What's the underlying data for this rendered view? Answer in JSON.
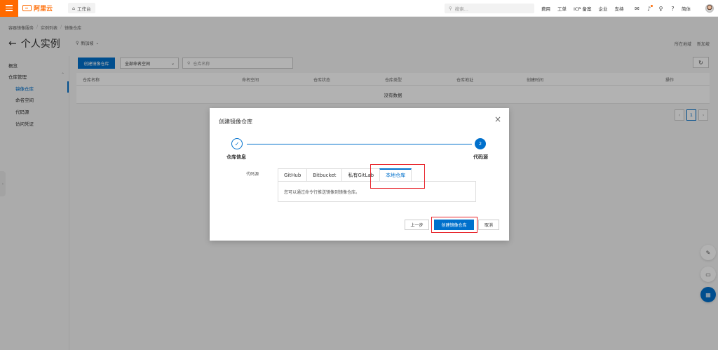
{
  "topnav": {
    "brand": "阿里云",
    "workbench": "工作台",
    "search_placeholder": "搜索...",
    "links": [
      "费用",
      "工单",
      "ICP 备案",
      "企业",
      "支持"
    ],
    "lang": "简体"
  },
  "breadcrumb": [
    "容器镜像服务",
    "实例列表",
    "镜像仓库"
  ],
  "page": {
    "title": "个人实例",
    "region": "新加坡",
    "region_links": [
      "所在地域",
      "新加坡"
    ]
  },
  "sidebar": {
    "overview": "概览",
    "group": "仓库管理",
    "items": [
      "镜像仓库",
      "命名空间",
      "代码源",
      "访问凭证"
    ]
  },
  "toolbar": {
    "create": "创建镜像仓库",
    "namespace": "全部命名空间",
    "search_placeholder": "仓库名称"
  },
  "table": {
    "headers": [
      "仓库名称",
      "命名空间",
      "仓库状态",
      "仓库类型",
      "仓库地址",
      "创建时间",
      "操作"
    ],
    "empty": "没有数据"
  },
  "pager": {
    "current": "1"
  },
  "dialog": {
    "title": "创建镜像仓库",
    "steps": [
      {
        "num": "1",
        "label": "仓库信息"
      },
      {
        "num": "2",
        "label": "代码源"
      }
    ],
    "source_label": "代码源",
    "tabs": [
      "GitHub",
      "Bitbucket",
      "私有GitLab",
      "本地仓库"
    ],
    "active_tab": "本地仓库",
    "tab_text": "您可以通过命令行推送镜像到镜像仓库。",
    "prev": "上一步",
    "create": "创建镜像仓库",
    "cancel": "取消"
  },
  "colors": {
    "primary": "#0070cc",
    "brand": "#ff6a00",
    "highlight": "#e8262d"
  }
}
